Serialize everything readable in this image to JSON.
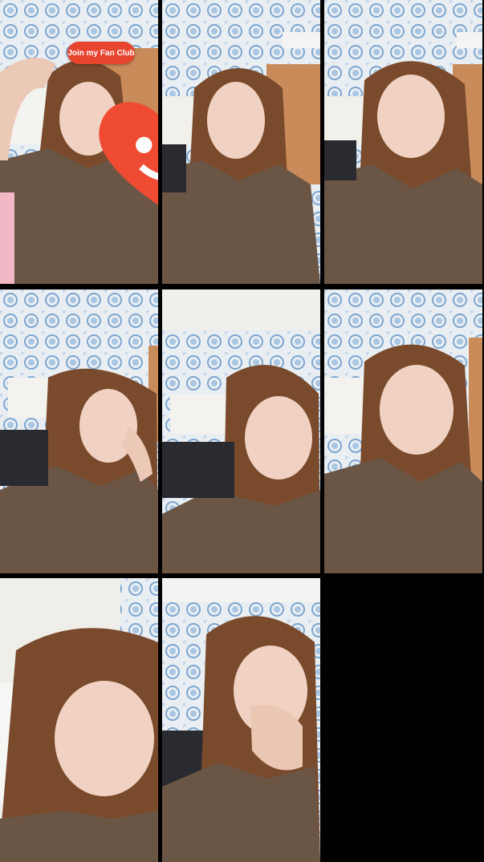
{
  "fan_club": {
    "label": "Join my Fan Club"
  },
  "colors": {
    "background": "#000000",
    "badge": "#e8452f",
    "wallpaper": "#e9eef3",
    "circle": "#8fb4d8",
    "shirt": "#6b5646",
    "hair": "#7a4a2c",
    "skin": "#f1d2c2"
  },
  "tiles": [
    {
      "id": 1,
      "has_fan_club": true
    },
    {
      "id": 2,
      "has_fan_club": false
    },
    {
      "id": 3,
      "has_fan_club": false
    },
    {
      "id": 4,
      "has_fan_club": false
    },
    {
      "id": 5,
      "has_fan_club": false
    },
    {
      "id": 6,
      "has_fan_club": false
    },
    {
      "id": 7,
      "has_fan_club": false
    },
    {
      "id": 8,
      "has_fan_club": false
    }
  ]
}
